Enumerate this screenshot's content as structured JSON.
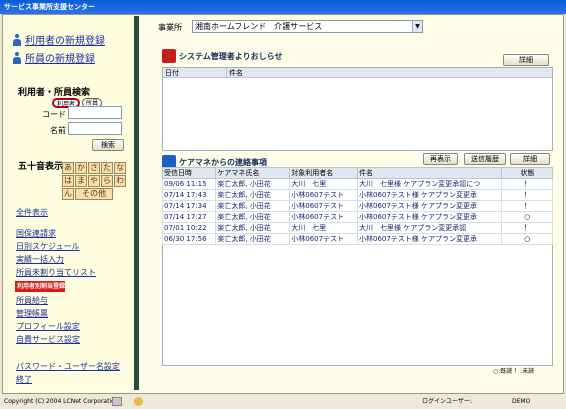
{
  "window": {
    "title": "サービス事業所支援センター"
  },
  "sidebar": {
    "register_user": "利用者の新規登録",
    "register_staff": "所員の新規登録",
    "search_heading": "利用者・所員検索",
    "radio_user": "利用者",
    "radio_staff": "所員",
    "code_label": "コード",
    "name_label": "名前",
    "gojuon_heading": "五十音表示",
    "search_button": "検索",
    "kana": [
      "あ",
      "か",
      "さ",
      "た",
      "な",
      "は",
      "ま",
      "や",
      "ら",
      "わ"
    ],
    "kana_n": "ん",
    "kana_other": "その他",
    "show_all": "全件表示",
    "nav": [
      "国保連請求",
      "日別スケジュール",
      "実績一括入力",
      "所員未割り当てリスト"
    ],
    "nav_highlight": "利用者別割当登録",
    "nav2": [
      "所員給与",
      "管理帳票",
      "プロフィール設定",
      "自費サービス設定"
    ],
    "password": "パスワード・ユーザー名設定",
    "logout": "終了"
  },
  "main": {
    "office_label": "事業所",
    "office_value": "湘南ホームフレンド　介護サービス",
    "sysadmin": {
      "title": "システム管理者よりおしらせ",
      "detail_btn": "詳細",
      "col_date": "日付",
      "col_subject": "件名"
    },
    "care_manager": {
      "title": "ケアマネからの連絡事項",
      "btn_reshow": "再表示",
      "btn_history": "送信履歴",
      "btn_detail": "詳細",
      "columns": [
        "受信日時",
        "ケアマネ氏名",
        "対象利用者名",
        "件名",
        "状態"
      ],
      "rows": [
        [
          "09/06 11:15",
          "楽亡太郎, 小田花",
          "大川　七里",
          "大川　七里様 ケアプラン変更承認につ",
          "！"
        ],
        [
          "07/14 17:43",
          "楽亡太郎, 小田花",
          "小林0607テスト",
          "小林0607テスト様 ケアプラン変更承",
          "！"
        ],
        [
          "07/14 17:34",
          "楽亡太郎, 小田花",
          "小林0607テスト",
          "小林0607テスト様 ケアプラン変更承",
          "！"
        ],
        [
          "07/14 17:27",
          "楽亡太郎, 小田花",
          "小林0607テスト",
          "小林0607テスト様 ケアプラン変更承",
          "○"
        ],
        [
          "07/01 10:22",
          "楽亡太郎, 小田花",
          "大川　七里",
          "大川　七里様 ケアプラン変更承認",
          "！"
        ],
        [
          "06/30 17:56",
          "楽亡太郎, 小田花",
          "小林0607テスト",
          "小林0607テスト様 ケアプラン変更承",
          "○"
        ]
      ],
      "legend": "○:既読 ！:未読"
    }
  },
  "statusbar": {
    "copyright": "Copyright (C) 2004 LCNet Corporation",
    "login_label": "ログインユーザー:",
    "login_user": "DEMO"
  },
  "colors": {
    "title_bar": "#0a5bd8",
    "sidebar_bg": "#fffde0",
    "highlight": "#d71c1c"
  }
}
